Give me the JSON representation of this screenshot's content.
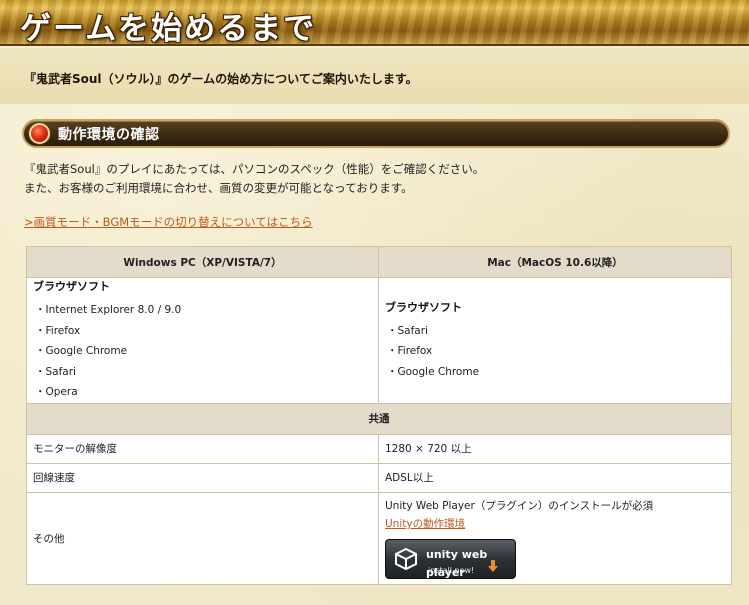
{
  "banner": {
    "title": "ゲームを始めるまで"
  },
  "intro": {
    "text": "『鬼武者Soul（ソウル）』のゲームの始め方についてご案内いたします。"
  },
  "section": {
    "title": "動作環境の確認",
    "desc_line1": "『鬼武者Soul』のプレイにあたっては、パソコンのスペック（性能）をご確認ください。",
    "desc_line2": "また、お客様のご利用環境に合わせ、画質の変更が可能となっております。",
    "toggle_link": ">画質モード・BGMモードの切り替えについてはこちら"
  },
  "table": {
    "header_windows": "Windows PC（XP/VISTA/7）",
    "header_mac": "Mac（MacOS 10.6以降）",
    "browser_heading": "ブラウザソフト",
    "windows_browsers": [
      "Internet Explorer 8.0 / 9.0",
      "Firefox",
      "Google Chrome",
      "Safari",
      "Opera"
    ],
    "mac_browsers": [
      "Safari",
      "Firefox",
      "Google Chrome"
    ],
    "common_header": "共通",
    "rows": [
      {
        "label": "モニターの解像度",
        "value": "1280 × 720 以上"
      },
      {
        "label": "回線速度",
        "value": "ADSL以上"
      }
    ],
    "other_label": "その他",
    "other_text": "Unity Web Player（プラグイン）のインストールが必須",
    "unity_link": "Unityの動作環境",
    "unity_button_title": "unity web player",
    "unity_button_sub": "install now!"
  },
  "colors": {
    "link": "#c0581e",
    "section_dot": "#e0301a",
    "table_header": "#e3dccb"
  }
}
